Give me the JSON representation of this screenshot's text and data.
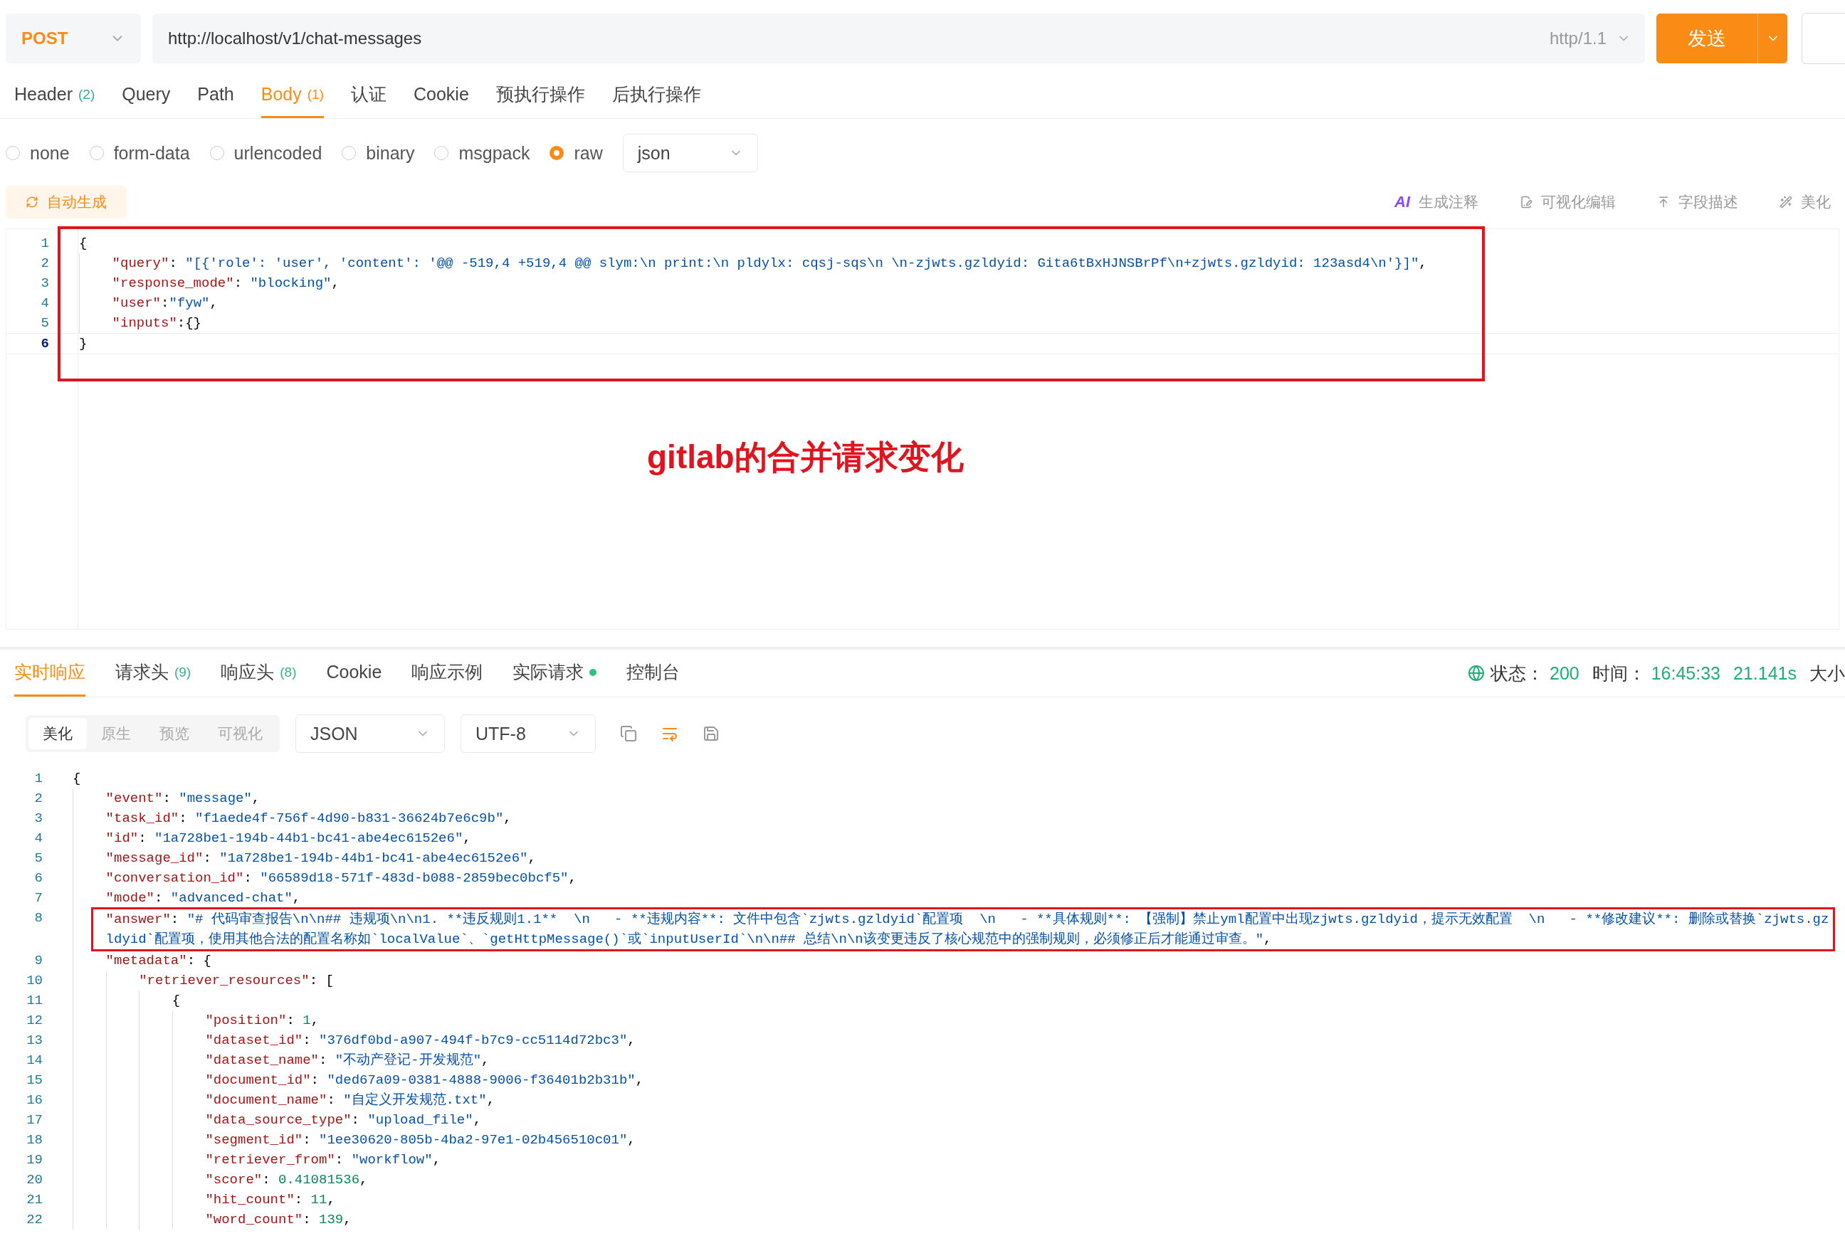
{
  "request": {
    "method": "POST",
    "url": "http://localhost/v1/chat-messages",
    "protocol": "http/1.1",
    "send_label": "发送",
    "tabs": [
      {
        "label": "Header",
        "count": "(2)",
        "selected": false
      },
      {
        "label": "Query",
        "selected": false
      },
      {
        "label": "Path",
        "selected": false
      },
      {
        "label": "Body",
        "count": "(1)",
        "selected": true
      },
      {
        "label": "认证",
        "selected": false
      },
      {
        "label": "Cookie",
        "selected": false
      },
      {
        "label": "预执行操作",
        "selected": false
      },
      {
        "label": "后执行操作",
        "selected": false
      }
    ],
    "body_types": [
      {
        "label": "none",
        "selected": false
      },
      {
        "label": "form-data",
        "selected": false
      },
      {
        "label": "urlencoded",
        "selected": false
      },
      {
        "label": "binary",
        "selected": false
      },
      {
        "label": "msgpack",
        "selected": false
      },
      {
        "label": "raw",
        "selected": true
      }
    ],
    "format": "json",
    "auto_generate": "自动生成",
    "actions": [
      {
        "kind": "ai",
        "badge": "AI",
        "label": "生成注释"
      },
      {
        "kind": "visual",
        "label": "可视化编辑"
      },
      {
        "kind": "fields",
        "label": "字段描述"
      },
      {
        "kind": "beautify",
        "label": "美化"
      }
    ],
    "editor": {
      "highlighted": true,
      "lines": [
        {
          "number": "1",
          "active": false,
          "tokens": [
            {
              "kind": "punct",
              "text": "{"
            }
          ]
        },
        {
          "number": "2",
          "active": false,
          "tokens": [
            {
              "kind": "key",
              "text": "    \"query\""
            },
            {
              "kind": "punct",
              "text": ": "
            },
            {
              "kind": "string",
              "text": "\"[{'role': 'user', 'content': '@@ -519,4 +519,4 @@ slym:\\n print:\\n pldylx: cqsj-sqs\\n \\n-zjwts.gzldyid: Gita6tBxHJNSBrPf\\n+zjwts.gzldyid: 123asd4\\n'}]\""
            },
            {
              "kind": "punct",
              "text": ","
            }
          ]
        },
        {
          "number": "3",
          "active": false,
          "tokens": [
            {
              "kind": "key",
              "text": "    \"response_mode\""
            },
            {
              "kind": "punct",
              "text": ": "
            },
            {
              "kind": "string",
              "text": "\"blocking\""
            },
            {
              "kind": "punct",
              "text": ","
            }
          ]
        },
        {
          "number": "4",
          "active": false,
          "tokens": [
            {
              "kind": "key",
              "text": "    \"user\""
            },
            {
              "kind": "punct",
              "text": ":"
            },
            {
              "kind": "string",
              "text": "\"fyw\""
            },
            {
              "kind": "punct",
              "text": ","
            }
          ]
        },
        {
          "number": "5",
          "active": false,
          "tokens": [
            {
              "kind": "key",
              "text": "    \"inputs\""
            },
            {
              "kind": "punct",
              "text": ":{}"
            }
          ]
        },
        {
          "number": "6",
          "active": true,
          "tokens": [
            {
              "kind": "punct",
              "text": "}"
            }
          ]
        }
      ]
    },
    "annotation": "gitlab的合并请求变化"
  },
  "response": {
    "tabs": [
      {
        "label": "实时响应",
        "selected": true,
        "indicator": false
      },
      {
        "label": "请求头",
        "count": "(9)",
        "selected": false,
        "indicator": false
      },
      {
        "label": "响应头",
        "count": "(8)",
        "selected": false,
        "indicator": false
      },
      {
        "label": "Cookie",
        "selected": false,
        "indicator": false
      },
      {
        "label": "响应示例",
        "selected": false,
        "indicator": false
      },
      {
        "label": "实际请求",
        "selected": false,
        "indicator": true
      },
      {
        "label": "控制台",
        "selected": false,
        "indicator": false
      }
    ],
    "status": {
      "status_label": "状态：",
      "status": "200",
      "time_label": "时间：",
      "time": "16:45:33",
      "duration": "21.141s",
      "size_label": "大小"
    },
    "view_modes": [
      {
        "label": "美化",
        "selected": true
      },
      {
        "label": "原生",
        "selected": false
      },
      {
        "label": "预览",
        "selected": false
      },
      {
        "label": "可视化",
        "selected": false
      }
    ],
    "content_type": "JSON",
    "encoding": "UTF-8",
    "tools": [
      {
        "kind": "copy",
        "on": false
      },
      {
        "kind": "wrap",
        "on": true
      },
      {
        "kind": "save",
        "on": false
      }
    ],
    "lines": [
      {
        "number": "1",
        "highlighted": false,
        "tokens": [
          {
            "kind": "punct",
            "text": "{"
          }
        ]
      },
      {
        "number": "2",
        "highlighted": false,
        "tokens": [
          {
            "kind": "key",
            "text": "    \"event\""
          },
          {
            "kind": "punct",
            "text": ": "
          },
          {
            "kind": "string",
            "text": "\"message\""
          },
          {
            "kind": "punct",
            "text": ","
          }
        ]
      },
      {
        "number": "3",
        "highlighted": false,
        "tokens": [
          {
            "kind": "key",
            "text": "    \"task_id\""
          },
          {
            "kind": "punct",
            "text": ": "
          },
          {
            "kind": "string",
            "text": "\"f1aede4f-756f-4d90-b831-36624b7e6c9b\""
          },
          {
            "kind": "punct",
            "text": ","
          }
        ]
      },
      {
        "number": "4",
        "highlighted": false,
        "tokens": [
          {
            "kind": "key",
            "text": "    \"id\""
          },
          {
            "kind": "punct",
            "text": ": "
          },
          {
            "kind": "string",
            "text": "\"1a728be1-194b-44b1-bc41-abe4ec6152e6\""
          },
          {
            "kind": "punct",
            "text": ","
          }
        ]
      },
      {
        "number": "5",
        "highlighted": false,
        "tokens": [
          {
            "kind": "key",
            "text": "    \"message_id\""
          },
          {
            "kind": "punct",
            "text": ": "
          },
          {
            "kind": "string",
            "text": "\"1a728be1-194b-44b1-bc41-abe4ec6152e6\""
          },
          {
            "kind": "punct",
            "text": ","
          }
        ]
      },
      {
        "number": "6",
        "highlighted": false,
        "tokens": [
          {
            "kind": "key",
            "text": "    \"conversation_id\""
          },
          {
            "kind": "punct",
            "text": ": "
          },
          {
            "kind": "string",
            "text": "\"66589d18-571f-483d-b088-2859bec0bcf5\""
          },
          {
            "kind": "punct",
            "text": ","
          }
        ]
      },
      {
        "number": "7",
        "highlighted": false,
        "tokens": [
          {
            "kind": "key",
            "text": "    \"mode\""
          },
          {
            "kind": "punct",
            "text": ": "
          },
          {
            "kind": "string",
            "text": "\"advanced-chat\""
          },
          {
            "kind": "punct",
            "text": ","
          }
        ]
      },
      {
        "number": "8",
        "highlighted": true,
        "tokens": [
          {
            "kind": "key",
            "text": "    \"answer\""
          },
          {
            "kind": "punct",
            "text": ": "
          },
          {
            "kind": "string",
            "text": "\"# 代码审查报告\\n\\n## 违规项\\n\\n1. **违反规则1.1**  \\n   - **违规内容**: 文件中包含`zjwts.gzldyid`配置项  \\n   - **具体规则**: 【强制】禁止yml配置中出现zjwts.gzldyid，提示无效配置  \\n   - **修改建议**: 删除或替换`zjwts.gzldyid`配置项，使用其他合法的配置名称如`localValue`、`getHttpMessage()`或`inputUserId`\\n\\n## 总结\\n\\n该变更违反了核心规范中的强制规则，必须修正后才能通过审查。\""
          },
          {
            "kind": "punct",
            "text": ","
          }
        ]
      },
      {
        "number": "9",
        "highlighted": false,
        "tokens": [
          {
            "kind": "key",
            "text": "    \"metadata\""
          },
          {
            "kind": "punct",
            "text": ": {"
          }
        ]
      },
      {
        "number": "10",
        "highlighted": false,
        "tokens": [
          {
            "kind": "key",
            "text": "        \"retriever_resources\""
          },
          {
            "kind": "punct",
            "text": ": ["
          }
        ]
      },
      {
        "number": "11",
        "highlighted": false,
        "tokens": [
          {
            "kind": "punct",
            "text": "            {"
          }
        ]
      },
      {
        "number": "12",
        "highlighted": false,
        "tokens": [
          {
            "kind": "key",
            "text": "                \"position\""
          },
          {
            "kind": "punct",
            "text": ": "
          },
          {
            "kind": "number",
            "text": "1"
          },
          {
            "kind": "punct",
            "text": ","
          }
        ]
      },
      {
        "number": "13",
        "highlighted": false,
        "tokens": [
          {
            "kind": "key",
            "text": "                \"dataset_id\""
          },
          {
            "kind": "punct",
            "text": ": "
          },
          {
            "kind": "string",
            "text": "\"376df0bd-a907-494f-b7c9-cc5114d72bc3\""
          },
          {
            "kind": "punct",
            "text": ","
          }
        ]
      },
      {
        "number": "14",
        "highlighted": false,
        "tokens": [
          {
            "kind": "key",
            "text": "                \"dataset_name\""
          },
          {
            "kind": "punct",
            "text": ": "
          },
          {
            "kind": "string",
            "text": "\"不动产登记-开发规范\""
          },
          {
            "kind": "punct",
            "text": ","
          }
        ]
      },
      {
        "number": "15",
        "highlighted": false,
        "tokens": [
          {
            "kind": "key",
            "text": "                \"document_id\""
          },
          {
            "kind": "punct",
            "text": ": "
          },
          {
            "kind": "string",
            "text": "\"ded67a09-0381-4888-9006-f36401b2b31b\""
          },
          {
            "kind": "punct",
            "text": ","
          }
        ]
      },
      {
        "number": "16",
        "highlighted": false,
        "tokens": [
          {
            "kind": "key",
            "text": "                \"document_name\""
          },
          {
            "kind": "punct",
            "text": ": "
          },
          {
            "kind": "string",
            "text": "\"自定义开发规范.txt\""
          },
          {
            "kind": "punct",
            "text": ","
          }
        ]
      },
      {
        "number": "17",
        "highlighted": false,
        "tokens": [
          {
            "kind": "key",
            "text": "                \"data_source_type\""
          },
          {
            "kind": "punct",
            "text": ": "
          },
          {
            "kind": "string",
            "text": "\"upload_file\""
          },
          {
            "kind": "punct",
            "text": ","
          }
        ]
      },
      {
        "number": "18",
        "highlighted": false,
        "tokens": [
          {
            "kind": "key",
            "text": "                \"segment_id\""
          },
          {
            "kind": "punct",
            "text": ": "
          },
          {
            "kind": "string",
            "text": "\"1ee30620-805b-4ba2-97e1-02b456510c01\""
          },
          {
            "kind": "punct",
            "text": ","
          }
        ]
      },
      {
        "number": "19",
        "highlighted": false,
        "tokens": [
          {
            "kind": "key",
            "text": "                \"retriever_from\""
          },
          {
            "kind": "punct",
            "text": ": "
          },
          {
            "kind": "string",
            "text": "\"workflow\""
          },
          {
            "kind": "punct",
            "text": ","
          }
        ]
      },
      {
        "number": "20",
        "highlighted": false,
        "tokens": [
          {
            "kind": "key",
            "text": "                \"score\""
          },
          {
            "kind": "punct",
            "text": ": "
          },
          {
            "kind": "number",
            "text": "0.41081536"
          },
          {
            "kind": "punct",
            "text": ","
          }
        ]
      },
      {
        "number": "21",
        "highlighted": false,
        "tokens": [
          {
            "kind": "key",
            "text": "                \"hit_count\""
          },
          {
            "kind": "punct",
            "text": ": "
          },
          {
            "kind": "number",
            "text": "11"
          },
          {
            "kind": "punct",
            "text": ","
          }
        ]
      },
      {
        "number": "22",
        "highlighted": false,
        "tokens": [
          {
            "kind": "key",
            "text": "                \"word_count\""
          },
          {
            "kind": "punct",
            "text": ": "
          },
          {
            "kind": "number",
            "text": "139"
          },
          {
            "kind": "punct",
            "text": ","
          }
        ]
      }
    ]
  }
}
